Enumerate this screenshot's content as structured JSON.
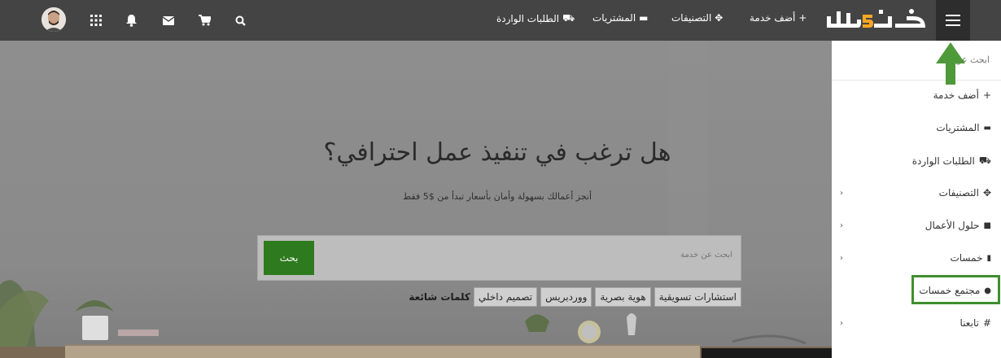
{
  "nav": {
    "add_service": "أضف خدمة",
    "categories": "التصنيفات",
    "purchases": "المشتريات",
    "incoming_requests": "الطلبات الواردة"
  },
  "hero": {
    "title": "هل ترغب في تنفيذ عمل احترافي؟",
    "subtitle": "أنجز أعمالك بسهولة وأمان بأسعار تبدأ من $5 فقط",
    "search_placeholder": "ابحث عن خدمة",
    "search_button": "بحث",
    "tags_label": "كلمات شائعة",
    "tags": [
      "تصميم داخلي",
      "ووردبريس",
      "هوية بصرية",
      "استشارات تسويقية"
    ]
  },
  "sidebar": {
    "search_placeholder": "ابحث عن...",
    "items": [
      {
        "label": "أضف خدمة",
        "icon": "plus-icon",
        "has_submenu": false
      },
      {
        "label": "المشتريات",
        "icon": "folder-icon",
        "has_submenu": false
      },
      {
        "label": "الطلبات الواردة",
        "icon": "truck-icon",
        "has_submenu": false
      },
      {
        "label": "التصنيفات",
        "icon": "cubes-icon",
        "has_submenu": true
      },
      {
        "label": "حلول الأعمال",
        "icon": "briefcase-icon",
        "has_submenu": true
      },
      {
        "label": "خمسات",
        "icon": "file-icon",
        "has_submenu": true
      },
      {
        "label": "مجتمع خمسات",
        "icon": "chat-icon",
        "has_submenu": false
      },
      {
        "label": "تابعنا",
        "icon": "hashtag-icon",
        "has_submenu": true
      }
    ]
  },
  "colors": {
    "topbar": "#444444",
    "brand_green": "#2e7a1e",
    "highlight_green": "#3f8f2f",
    "logo_orange": "#f5a623"
  }
}
